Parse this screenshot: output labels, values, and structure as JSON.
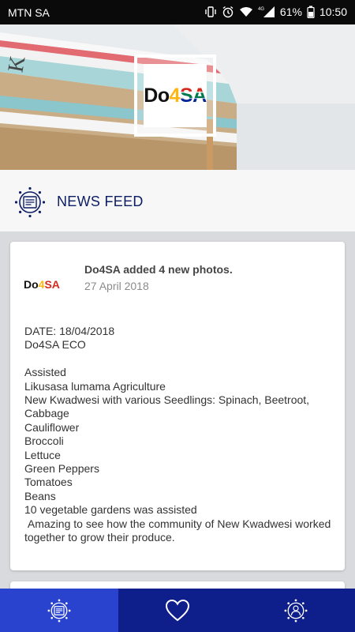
{
  "status_bar": {
    "carrier": "MTN SA",
    "battery": "61%",
    "time": "10:50",
    "icons": [
      "vibrate-icon",
      "alarm-icon",
      "wifi-icon",
      "signal-4g-icon",
      "battery-icon"
    ]
  },
  "hero": {
    "logo": {
      "text_prefix": "Do",
      "text_digit": "4",
      "text_suffix": "SA"
    }
  },
  "section": {
    "title": "NEWS FEED"
  },
  "post": {
    "author_line": "Do4SA added 4 new photos.",
    "date": "27 April 2018",
    "logo": {
      "text_prefix": "Do",
      "text_digit": "4",
      "text_suffix": "SA"
    },
    "body": "DATE: 18/04/2018\nDo4SA ECO\n\nAssisted\nLikusasa lumama Agriculture\nNew Kwadwesi with various Seedlings: Spinach, Beetroot, Cabbage\nCauliflower\nBroccoli\nLettuce\nGreen Peppers\nTomatoes\nBeans\n10 vegetable gardens was assisted\n Amazing to see how the community of New Kwadwesi worked together to grow their produce."
  },
  "bottom_nav": {
    "tabs": [
      {
        "icon": "news-feed-icon",
        "active": true
      },
      {
        "icon": "heart-icon",
        "active": false
      },
      {
        "icon": "profile-icon",
        "active": false
      }
    ]
  },
  "colors": {
    "primary_dark": "#0e1f8c",
    "primary_active": "#2a43cf",
    "title_text": "#0d1d63",
    "logo_red": "#d52b1e",
    "logo_green": "#007a4d",
    "logo_gold": "#ffb612",
    "logo_blue": "#002395"
  }
}
